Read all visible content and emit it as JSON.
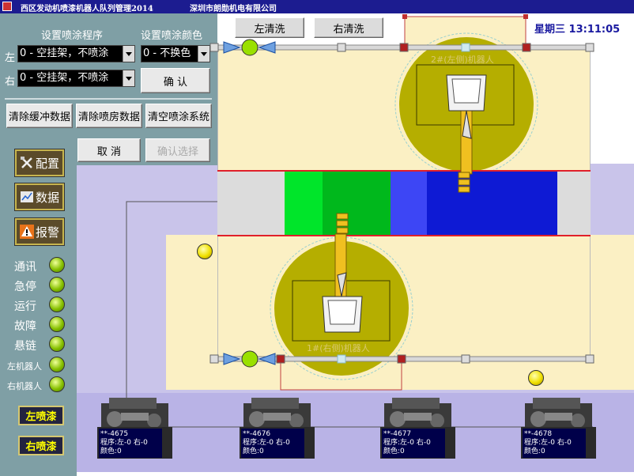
{
  "window": {
    "title_left": "西区发动机喷漆机器人队列管理2014",
    "title_right": "深圳市朗勋机电有限公司"
  },
  "program_panel": {
    "program_header": "设置喷涂程序",
    "color_header": "设置喷涂颜色",
    "left_label": "左",
    "right_label": "右",
    "left_program": "0 - 空挂架，不喷涂",
    "right_program": "0 - 空挂架，不喷涂",
    "color_value": "0 - 不换色",
    "confirm": "确 认"
  },
  "clear_buttons": {
    "buffer": "清除缓冲数据",
    "booth": "清除喷房数据",
    "system": "清空喷涂系统"
  },
  "dialog": {
    "cancel": "取 消",
    "confirm_select": "确认选择"
  },
  "nav": {
    "config": "配置",
    "data": "数据",
    "alarm": "报警"
  },
  "status": [
    {
      "label": "通讯"
    },
    {
      "label": "急停"
    },
    {
      "label": "运行"
    },
    {
      "label": "故障"
    },
    {
      "label": "悬链"
    },
    {
      "label": "左机器人"
    },
    {
      "label": "右机器人"
    }
  ],
  "spray": {
    "left": "左喷漆",
    "right": "右喷漆"
  },
  "top_buttons": {
    "left_clean": "左清洗",
    "right_clean": "右清洗"
  },
  "clock": "星期三 13:11:05",
  "robots": {
    "upper": "2#(左侧)机器人",
    "lower": "1#(右侧)机器人"
  },
  "color_bands": [
    "#dcdcdc",
    "#00e52a",
    "#00b81c",
    "#3d46f5",
    "#0e1ad4",
    "#dcdcdc"
  ],
  "engines": [
    {
      "id": "**-4675",
      "program": "程序:左-0 右-0",
      "color": "颜色:0"
    },
    {
      "id": "**-4676",
      "program": "程序:左-0 右-0",
      "color": "颜色:0"
    },
    {
      "id": "**-4677",
      "program": "程序:左-0 右-0",
      "color": "颜色:0"
    },
    {
      "id": "**-4678",
      "program": "程序:左-0 右-0",
      "color": "颜色:0"
    }
  ]
}
